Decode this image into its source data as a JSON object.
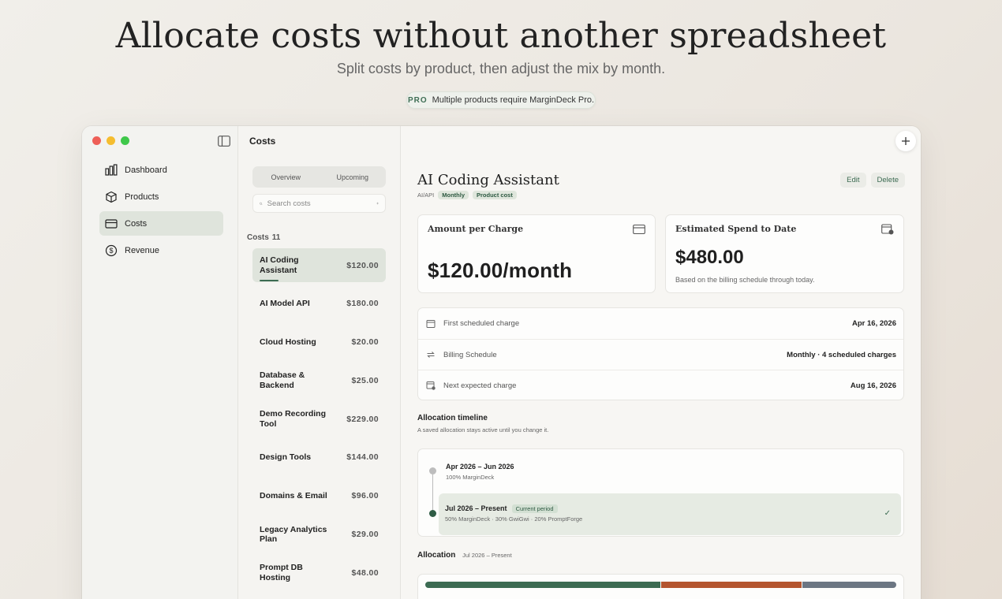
{
  "hero": {
    "title": "Allocate costs without another spreadsheet",
    "subtitle": "Split costs by product, then adjust the mix by month.",
    "pro_tag": "PRO",
    "pro_text": "Multiple products require MarginDeck Pro."
  },
  "sidebar": {
    "items": [
      {
        "label": "Dashboard",
        "icon": "bar-chart-icon"
      },
      {
        "label": "Products",
        "icon": "box-icon"
      },
      {
        "label": "Costs",
        "icon": "credit-card-icon",
        "active": true
      },
      {
        "label": "Revenue",
        "icon": "dollar-circle-icon"
      }
    ]
  },
  "list": {
    "title": "Costs",
    "tabs": [
      "Overview",
      "Upcoming"
    ],
    "search_placeholder": "Search costs",
    "section_label": "Costs",
    "section_count": "11",
    "items": [
      {
        "name": "AI Coding Assistant",
        "amount": "$120.00"
      },
      {
        "name": "AI Model API",
        "amount": "$180.00"
      },
      {
        "name": "Cloud Hosting",
        "amount": "$20.00"
      },
      {
        "name": "Database & Backend",
        "amount": "$25.00"
      },
      {
        "name": "Demo Recording Tool",
        "amount": "$229.00"
      },
      {
        "name": "Design Tools",
        "amount": "$144.00"
      },
      {
        "name": "Domains & Email",
        "amount": "$96.00"
      },
      {
        "name": "Legacy Analytics Plan",
        "amount": "$29.00"
      },
      {
        "name": "Prompt DB Hosting",
        "amount": "$48.00"
      }
    ]
  },
  "detail": {
    "title": "AI Coding Assistant",
    "category": "AI/API",
    "chip_frequency": "Monthly",
    "chip_type": "Product cost",
    "edit_label": "Edit",
    "delete_label": "Delete",
    "amount_card": {
      "title": "Amount per Charge",
      "value": "$120.00/month"
    },
    "spend_card": {
      "title": "Estimated Spend to Date",
      "value": "$480.00",
      "note": "Based on the billing schedule through today."
    },
    "info": [
      {
        "label": "First scheduled charge",
        "value": "Apr 16, 2026"
      },
      {
        "label": "Billing Schedule",
        "value": "Monthly · 4 scheduled charges"
      },
      {
        "label": "Next expected charge",
        "value": "Aug 16, 2026"
      }
    ],
    "timeline": {
      "title": "Allocation timeline",
      "subtitle": "A saved allocation stays active until you change it.",
      "periods": [
        {
          "range": "Apr 2026 – Jun 2026",
          "split": "100% MarginDeck"
        },
        {
          "range": "Jul 2026 – Present",
          "split": "50% MarginDeck · 30% GwiGwi · 20% PromptForge",
          "badge": "Current period"
        }
      ]
    },
    "allocation": {
      "title": "Allocation",
      "period": "Jul 2026 – Present",
      "segments": [
        {
          "product": "MarginDeck",
          "percent": 50,
          "color": "#3c6b52"
        },
        {
          "product": "GwiGwi",
          "percent": 30,
          "color": "#b4552f"
        },
        {
          "product": "PromptForge",
          "percent": 20,
          "color": "#6c7683"
        }
      ]
    }
  }
}
